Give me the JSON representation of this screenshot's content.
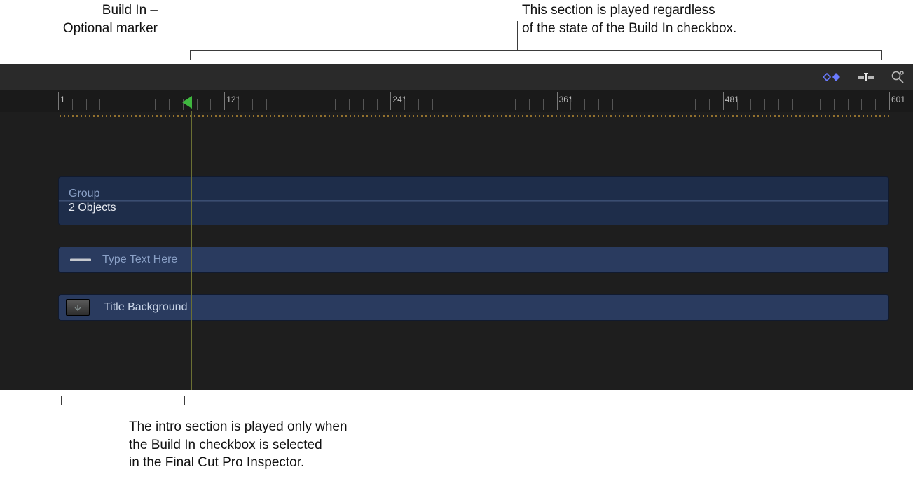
{
  "callouts": {
    "top_left_line1": "Build In –",
    "top_left_line2": "Optional marker",
    "top_right_line1": "This section is played regardless",
    "top_right_line2": "of the state of the Build In checkbox.",
    "bottom_line1": "The intro section is played only when",
    "bottom_line2": "the Build In checkbox is selected",
    "bottom_line3": "in the Final Cut Pro Inspector."
  },
  "ruler": {
    "start_frame": 1,
    "major_interval": 120,
    "minor_per_major": 12,
    "labels": [
      "1",
      "121",
      "241",
      "361",
      "481",
      "601"
    ],
    "marker_frame": 97
  },
  "tracks": {
    "group_title": "Group",
    "group_subtitle": "2 Objects",
    "text_layer_label": "Type Text Here",
    "bg_layer_label": "Title Background"
  },
  "toolbar": {
    "keyframe_tool": "keyframe-tool",
    "clip_tool": "clip-trim-tool",
    "zoom_tool": "zoom-tool"
  }
}
